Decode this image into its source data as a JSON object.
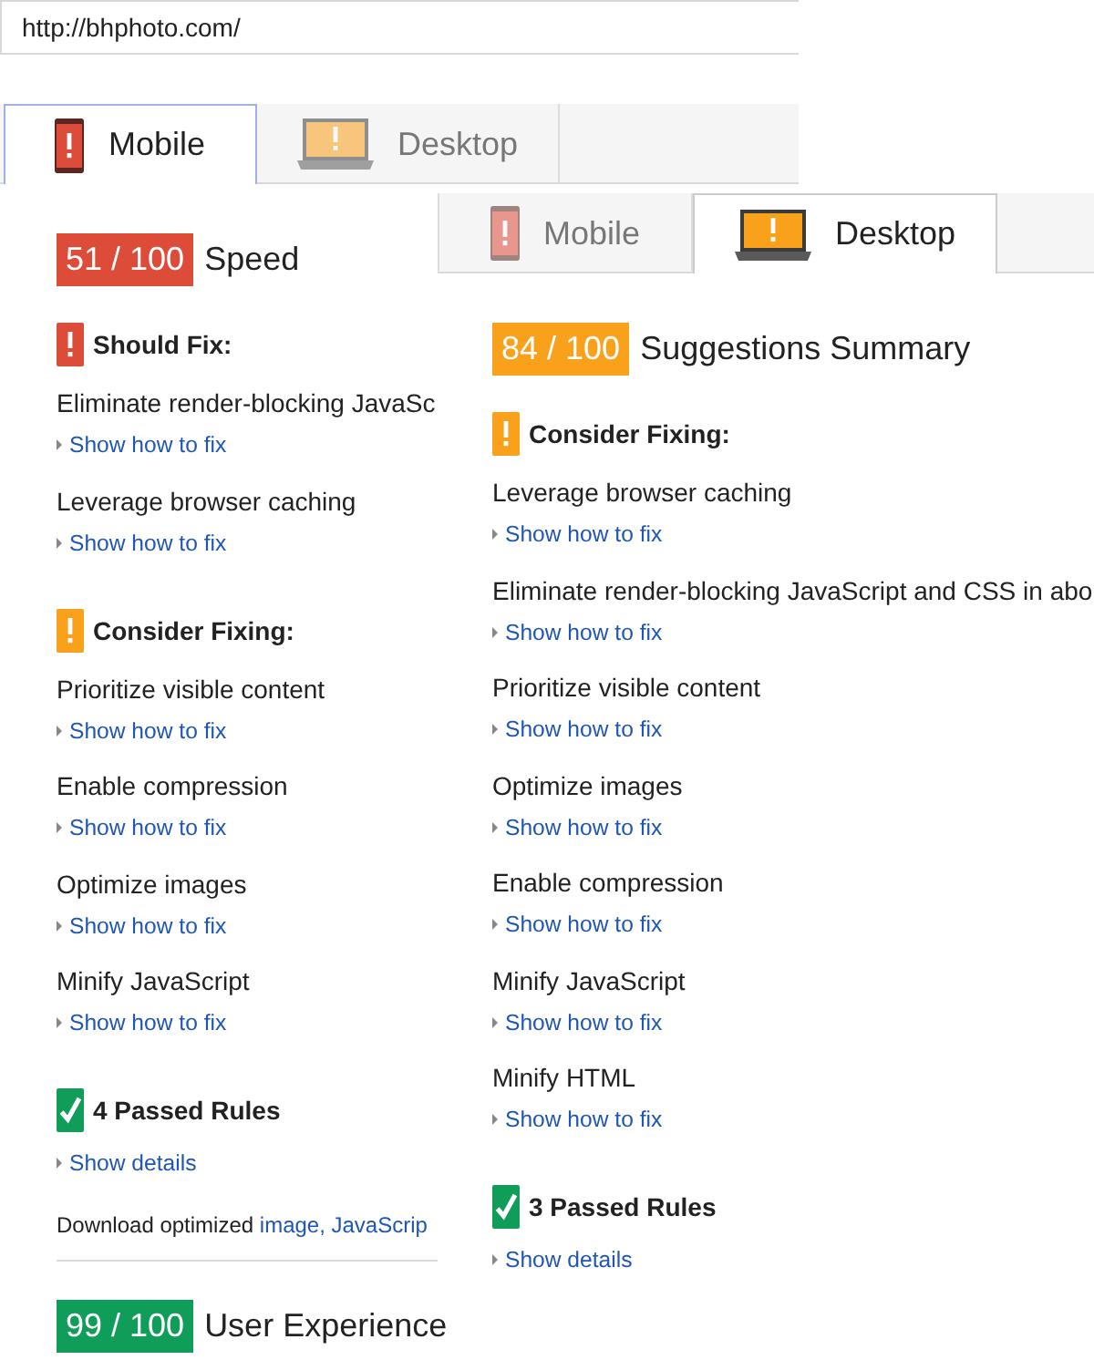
{
  "url_field": {
    "value": "http://bhphoto.com/"
  },
  "mobile_report": {
    "tabs": [
      {
        "kind": "mobile",
        "label": "Mobile",
        "selected": true,
        "focused": true
      },
      {
        "kind": "desktop",
        "label": "Desktop",
        "selected": false,
        "focused": false
      }
    ],
    "score": {
      "value": "51 / 100",
      "color": "#dd4b39",
      "label": "Speed"
    },
    "sections": [
      {
        "kind": "should_fix",
        "heading": "Should Fix:",
        "rules": [
          {
            "title": "Eliminate render-blocking JavaSc",
            "link": "Show how to fix",
            "expanded": false
          },
          {
            "title": "Leverage browser caching",
            "link": "Show how to fix",
            "expanded": false
          }
        ]
      },
      {
        "kind": "consider_fixing",
        "heading": "Consider Fixing:",
        "rules": [
          {
            "title": "Prioritize visible content",
            "link": "Show how to fix",
            "expanded": false
          },
          {
            "title": "Enable compression",
            "link": "Show how to fix",
            "expanded": false
          },
          {
            "title": "Optimize images",
            "link": "Show how to fix",
            "expanded": false
          },
          {
            "title": "Minify JavaScript",
            "link": "Show how to fix",
            "expanded": false
          }
        ]
      },
      {
        "kind": "passed",
        "heading": "4 Passed Rules",
        "link": "Show details",
        "expanded": false
      }
    ],
    "download_note": {
      "text": "Download optimized",
      "link": "image, JavaScrip"
    },
    "footer_score": {
      "value": "99 / 100",
      "color": "#109d59",
      "label": "User Experience"
    }
  },
  "desktop_report": {
    "tabs": [
      {
        "kind": "mobile",
        "label": "Mobile",
        "selected": false,
        "focused": false
      },
      {
        "kind": "desktop",
        "label": "Desktop",
        "selected": true,
        "focused": false
      }
    ],
    "score": {
      "value": "84 / 100",
      "color": "#f9a11b",
      "label": "Suggestions Summary"
    },
    "sections": [
      {
        "kind": "consider_fixing",
        "heading": "Consider Fixing:",
        "rules": [
          {
            "title": "Leverage browser caching",
            "link": "Show how to fix",
            "expanded": false
          },
          {
            "title": "Eliminate render-blocking JavaScript and CSS in abo",
            "link": "Show how to fix",
            "expanded": false
          },
          {
            "title": "Prioritize visible content",
            "link": "Show how to fix",
            "expanded": false
          },
          {
            "title": "Optimize images",
            "link": "Show how to fix",
            "expanded": false
          },
          {
            "title": "Enable compression",
            "link": "Show how to fix",
            "expanded": false
          },
          {
            "title": "Minify JavaScript",
            "link": "Show how to fix",
            "expanded": false
          },
          {
            "title": "Minify HTML",
            "link": "Show how to fix",
            "expanded": false
          }
        ]
      },
      {
        "kind": "passed",
        "heading": "3 Passed Rules",
        "link": "Show details",
        "expanded": false
      }
    ]
  }
}
